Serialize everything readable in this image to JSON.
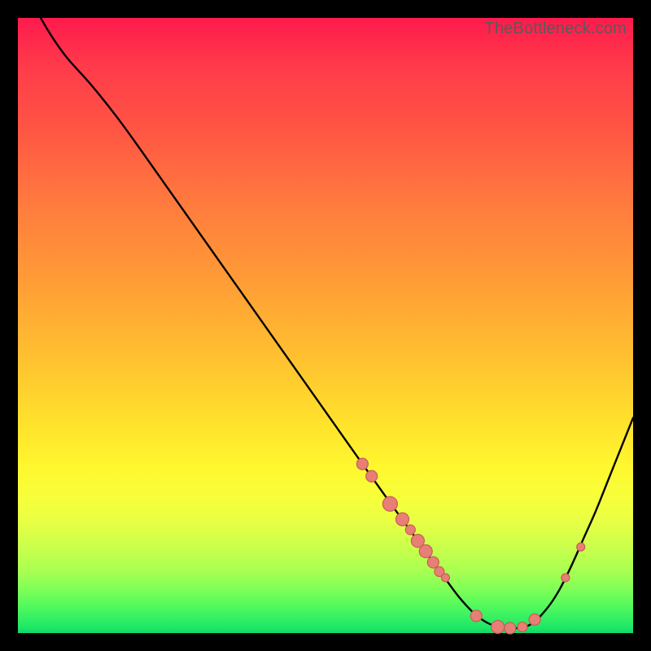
{
  "watermark": "TheBottleneck.com",
  "colors": {
    "background": "#000000",
    "gradient_top": "#ff1a4d",
    "gradient_bottom": "#0fd869",
    "curve_stroke": "#000000",
    "marker_fill": "#e77f76",
    "marker_stroke": "#c95d53"
  },
  "chart_data": {
    "type": "line",
    "title": "",
    "xlabel": "",
    "ylabel": "",
    "xlim": [
      0,
      100
    ],
    "ylim": [
      0,
      100
    ],
    "curve": [
      {
        "x": 3.7,
        "y": 100
      },
      {
        "x": 5.5,
        "y": 97
      },
      {
        "x": 8,
        "y": 93.5
      },
      {
        "x": 12,
        "y": 89
      },
      {
        "x": 16,
        "y": 84
      },
      {
        "x": 20,
        "y": 78.5
      },
      {
        "x": 26,
        "y": 70
      },
      {
        "x": 32,
        "y": 61.5
      },
      {
        "x": 38,
        "y": 53
      },
      {
        "x": 44,
        "y": 44.5
      },
      {
        "x": 50,
        "y": 36
      },
      {
        "x": 56,
        "y": 27.5
      },
      {
        "x": 61,
        "y": 20.5
      },
      {
        "x": 65,
        "y": 15
      },
      {
        "x": 69,
        "y": 9.5
      },
      {
        "x": 72,
        "y": 5.5
      },
      {
        "x": 75,
        "y": 2.5
      },
      {
        "x": 78,
        "y": 1
      },
      {
        "x": 81,
        "y": 0.8
      },
      {
        "x": 83.5,
        "y": 1.5
      },
      {
        "x": 86,
        "y": 4
      },
      {
        "x": 88,
        "y": 7
      },
      {
        "x": 90,
        "y": 11
      },
      {
        "x": 92,
        "y": 15.5
      },
      {
        "x": 94,
        "y": 20
      },
      {
        "x": 96,
        "y": 25
      },
      {
        "x": 98,
        "y": 30
      },
      {
        "x": 100,
        "y": 35
      }
    ],
    "markers": [
      {
        "x": 56,
        "y": 27.5,
        "r": 7
      },
      {
        "x": 57.5,
        "y": 25.5,
        "r": 7
      },
      {
        "x": 60.5,
        "y": 21,
        "r": 9
      },
      {
        "x": 62.5,
        "y": 18.5,
        "r": 8
      },
      {
        "x": 63.8,
        "y": 16.8,
        "r": 6
      },
      {
        "x": 65,
        "y": 15,
        "r": 8
      },
      {
        "x": 66.3,
        "y": 13.3,
        "r": 8
      },
      {
        "x": 67.5,
        "y": 11.5,
        "r": 7
      },
      {
        "x": 68.5,
        "y": 10,
        "r": 6
      },
      {
        "x": 69.5,
        "y": 9,
        "r": 5
      },
      {
        "x": 74.5,
        "y": 2.8,
        "r": 7
      },
      {
        "x": 78,
        "y": 1,
        "r": 8
      },
      {
        "x": 80,
        "y": 0.8,
        "r": 7
      },
      {
        "x": 82,
        "y": 1,
        "r": 6
      },
      {
        "x": 84,
        "y": 2.2,
        "r": 7
      },
      {
        "x": 89,
        "y": 9,
        "r": 5
      },
      {
        "x": 91.5,
        "y": 14,
        "r": 5
      }
    ]
  }
}
